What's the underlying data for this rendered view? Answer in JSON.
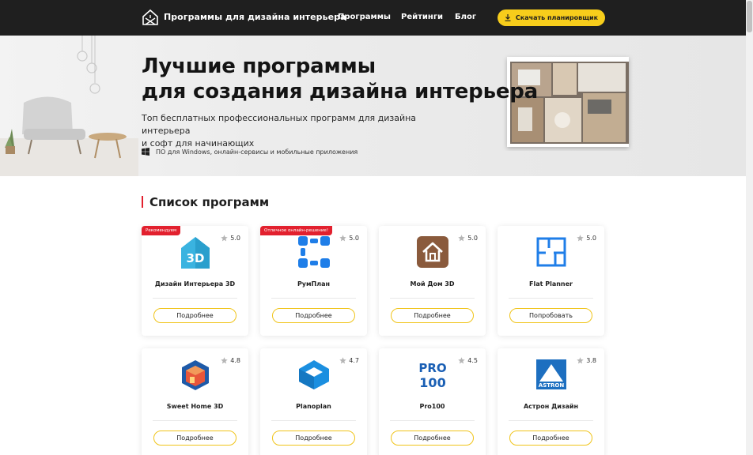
{
  "header": {
    "brand": "Программы для дизайна интерьера",
    "nav": [
      "Программы",
      "Рейтинги",
      "Блог"
    ],
    "download_label": "Скачать планировщик",
    "accent": "#f7cd1b",
    "logo_icon": "house-logo-icon"
  },
  "hero": {
    "title_line1": "Лучшие программы",
    "title_line2": "для создания дизайна интерьера",
    "subtitle_line1": "Топ бесплатных профессиональных программ для дизайна интерьера",
    "subtitle_line2": "и софт для начинающих",
    "note": "ПО для Windows, онлайн-сервисы и мобильные приложения",
    "note_icon": "windows-icon"
  },
  "section": {
    "title": "Список программ",
    "accent": "#e2202e"
  },
  "cards": [
    {
      "name": "Дизайн Интерьера 3D",
      "rating": "5.0",
      "badge": "Рекомендуем",
      "button": "Подробнее",
      "icon": "3d-house-icon"
    },
    {
      "name": "РумПлан",
      "rating": "5.0",
      "badge": "Отличное онлайн-решение!",
      "button": "Подробнее",
      "icon": "roomplan-icon"
    },
    {
      "name": "Мой Дом 3D",
      "rating": "5.0",
      "badge": "",
      "button": "Подробнее",
      "icon": "home-icon"
    },
    {
      "name": "Flat Planner",
      "rating": "5.0",
      "badge": "",
      "button": "Попробовать",
      "icon": "floorplan-icon"
    },
    {
      "name": "Sweet Home 3D",
      "rating": "4.8",
      "badge": "",
      "button": "Подробнее",
      "icon": "sweethome-icon"
    },
    {
      "name": "Planoplan",
      "rating": "4.7",
      "badge": "",
      "button": "Подробнее",
      "icon": "planoplan-icon"
    },
    {
      "name": "Pro100",
      "rating": "4.5",
      "badge": "",
      "button": "Подробнее",
      "icon": "pro100-icon"
    },
    {
      "name": "Астрон Дизайн",
      "rating": "3.8",
      "badge": "",
      "button": "Подробнее",
      "icon": "astron-icon"
    }
  ],
  "astron_logo_text": "ASTRON",
  "pro100_logo_text": "PRO 100"
}
